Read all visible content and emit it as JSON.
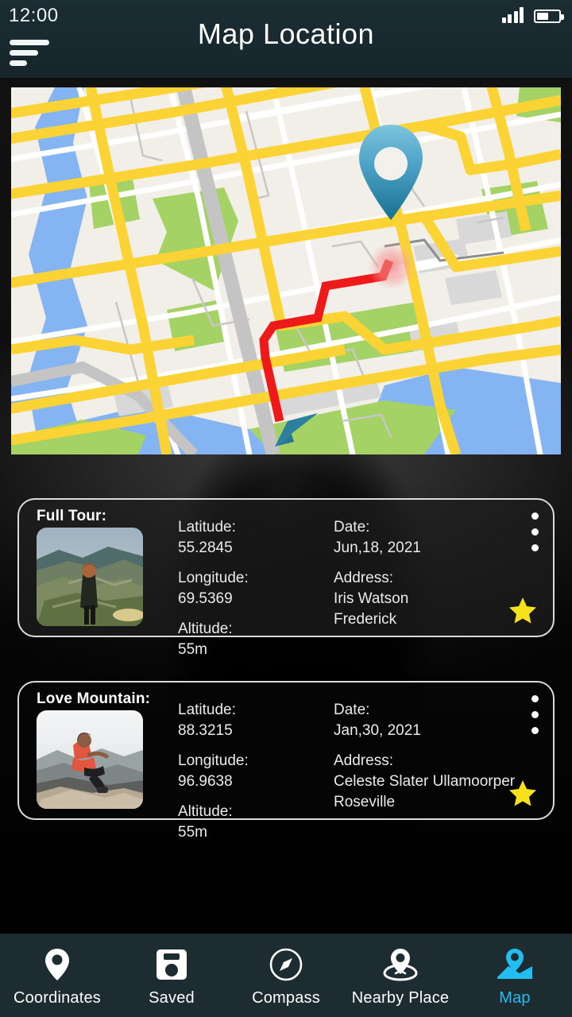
{
  "statusbar": {
    "time": "12:00",
    "signal_icon": "signal-bars-icon",
    "battery_icon": "battery-icon"
  },
  "header": {
    "title": "Map Location",
    "menu_icon": "hamburger-menu-icon",
    "background": "#18292e"
  },
  "map": {
    "name": "map-view",
    "pin_icon": "location-pin-marker",
    "arrow_icon": "navigation-arrow-marker",
    "route_color": "#ee1a1a",
    "road_color": "#fbd335",
    "water_color": "#85b4f2",
    "park_color": "#a5d264",
    "land_color": "#f2efe9"
  },
  "cards": [
    {
      "title": "Full Tour:",
      "thumbnail": "hiker-on-mountain-photo",
      "fields": [
        {
          "label": "Latitude:",
          "value": "55.2845"
        },
        {
          "label": "Longitude:",
          "value": "69.5369"
        },
        {
          "label": "Altitude:",
          "value": "55m"
        }
      ],
      "fields_right": [
        {
          "label": "Date:",
          "value": "Jun,18, 2021"
        },
        {
          "label": "Address:",
          "value": "Iris Watson",
          "value2": "Frederick"
        }
      ],
      "menu_icon": "kebab-menu-icon",
      "star_icon": "star-favorite-icon",
      "star_color": "#f6e11a"
    },
    {
      "title": "Love Mountain:",
      "thumbnail": "person-sitting-on-rock-photo",
      "fields": [
        {
          "label": "Latitude:",
          "value": "88.3215"
        },
        {
          "label": "Longitude:",
          "value": "96.9638"
        },
        {
          "label": "Altitude:",
          "value": "55m"
        }
      ],
      "fields_right": [
        {
          "label": "Date:",
          "value": "Jan,30, 2021"
        },
        {
          "label": "Address:",
          "value": "Celeste Slater Ullamoorper",
          "value2": "Roseville"
        }
      ],
      "menu_icon": "kebab-menu-icon",
      "star_icon": "star-favorite-icon",
      "star_color": "#f6e11a"
    }
  ],
  "bottom_nav": {
    "active_color": "#24bdf0",
    "inactive_color": "#ffffff",
    "items": [
      {
        "label": "Coordinates",
        "icon": "location-pin-icon",
        "active": false
      },
      {
        "label": "Saved",
        "icon": "floppy-disk-icon",
        "active": false
      },
      {
        "label": "Compass",
        "icon": "compass-icon",
        "active": false
      },
      {
        "label": "Nearby Place",
        "icon": "nearby-place-icon",
        "active": false
      },
      {
        "label": "Map",
        "icon": "map-folded-icon",
        "active": true
      }
    ]
  }
}
